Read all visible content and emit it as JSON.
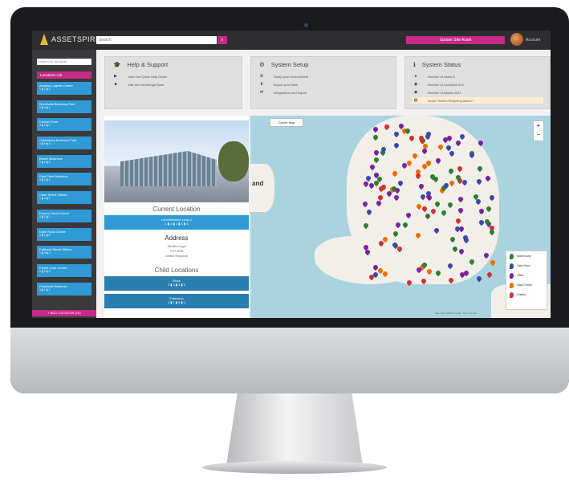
{
  "app": {
    "name": "ASSETSPIRE",
    "search_placeholder": "Search",
    "update_button": "Update Site Asset",
    "user": "Account"
  },
  "sidebar": {
    "search_placeholder": "Search for an Asset",
    "header": "Locations List",
    "items": [
      {
        "label": "Aviation Logistic Centre",
        "sub": "1 ▮ 2 ▮ 3"
      },
      {
        "label": "Brookvale Business Park",
        "sub": "2 ▮ 4 ▮ 1"
      },
      {
        "label": "Carlyle Court",
        "sub": "3 ▮ 1 ▮ 2"
      },
      {
        "label": "Canterbury Business Park",
        "sub": "1 ▮ 5 ▮ 3"
      },
      {
        "label": "Beach Business",
        "sub": "2 ▮ 2 ▮ 4"
      },
      {
        "label": "East Point Business",
        "sub": "4 ▮ 1 ▮ 2"
      },
      {
        "label": "Clare Street Offices",
        "sub": "1 ▮ 3 ▮ 1"
      },
      {
        "label": "Dovers Grove House",
        "sub": "3 ▮ 2 ▮ 2"
      },
      {
        "label": "Dyke Road Centre",
        "sub": "2 ▮ 1 ▮ 5"
      },
      {
        "label": "Falkland Street Offices",
        "sub": "1 ▮ 4 ▮ 2"
      },
      {
        "label": "Forest Lane Centre",
        "sub": "2 ▮ 2 ▮ 3"
      },
      {
        "label": "Frankwell Business",
        "sub": "3 ▮ 1 ▮ 1"
      }
    ],
    "footer": "+ ADD LOCATION (10)"
  },
  "panels": {
    "help": {
      "title": "Help & Support",
      "rows": [
        "View Our Quick Help Guide",
        "Visit the Knowledge Base"
      ]
    },
    "setup": {
      "title": "System Setup",
      "rows": [
        "Setup your Environment",
        "Import your Data",
        "Integrations and Import"
      ]
    },
    "status": {
      "title": "System Status",
      "rows": [
        "Number of Users 8",
        "Number of Locations 513",
        "Number of Assets 4221",
        "Active Tickets Requiring Action 7"
      ]
    }
  },
  "location": {
    "current_title": "Current Location",
    "current_name": "Leicestershire Loop 1",
    "current_sub": "1 ▮ 2 ▮ 1 ▮ 4 ▮ 3",
    "address_title": "Address",
    "address_lines": [
      "Tandborough",
      "CV7 8HB",
      "United Kingdom"
    ],
    "child_title": "Child Locations",
    "child": [
      {
        "name": "Block",
        "sub": "1 ▮ 3 ▮ 1 ▮ 2"
      },
      {
        "name": "Extension",
        "sub": "2 ▮ 1 ▮ 4 ▮ 1"
      }
    ]
  },
  "map": {
    "button": "Carrier Map",
    "visible_word": "and",
    "zoom_in": "+",
    "zoom_out": "−",
    "attribution": "Map data ©2018 Google, Terms of Use",
    "legend": [
      {
        "label": "Warehouse",
        "color": "#2e7d32"
      },
      {
        "label": "Data Store",
        "color": "#3949ab"
      },
      {
        "label": "Office",
        "color": "#7b1fa2"
      },
      {
        "label": "Data Centre",
        "color": "#ef6c00"
      },
      {
        "label": "Outlets",
        "color": "#d32f2f"
      }
    ]
  },
  "colors": {
    "accent": "#c42a86",
    "primary": "#2f9ad6",
    "bezel": "#1b1b1d"
  }
}
